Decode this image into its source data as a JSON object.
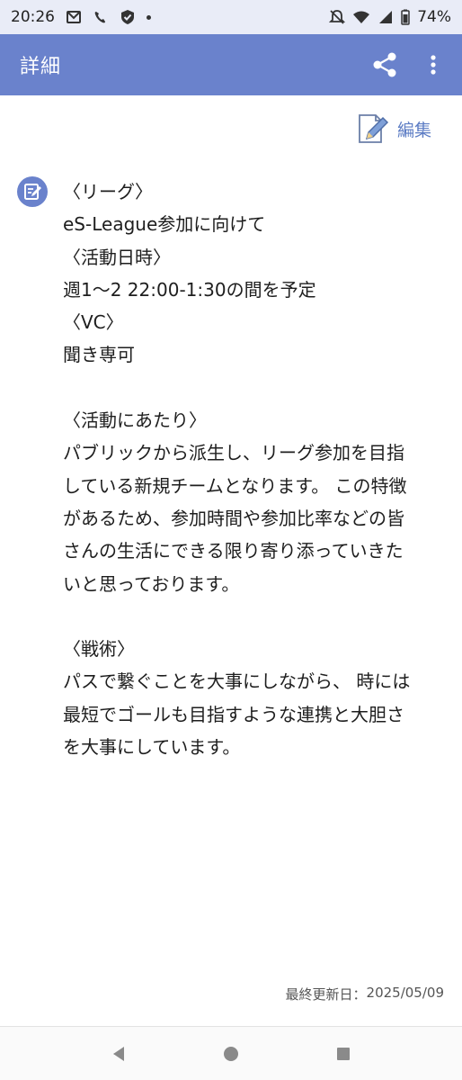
{
  "status_bar": {
    "time": "20:26",
    "battery": "74%",
    "left_icons": [
      "mail-icon",
      "wifi-call-icon",
      "shield-check-icon",
      "notification-dot-icon"
    ],
    "right_icons": [
      "mute-icon",
      "wifi-icon",
      "signal-icon",
      "battery-icon"
    ]
  },
  "app_bar": {
    "title": "詳細",
    "share_icon": "share-icon",
    "menu_icon": "more-vert-icon"
  },
  "edit": {
    "label": "編集",
    "icon": "edit-document-icon"
  },
  "note": {
    "icon": "note-edit-icon",
    "lines": [
      "〈リーグ〉",
      "eS-League参加に向けて",
      "〈活動日時〉",
      "週1〜2 22:00-1:30の間を予定",
      "〈VC〉",
      "聞き専可",
      "",
      "〈活動にあたり〉",
      "パブリックから派生し、リーグ参加を目指",
      "している新規チームとなります。 この特徴",
      "があるため、参加時間や参加比率などの皆",
      "さんの生活にできる限り寄り添っていきた",
      "いと思っております。",
      "",
      "〈戦術〉",
      "パスで繋ぐことを大事にしながら、 時には",
      "最短でゴールも目指すような連携と大胆さ",
      "を大事にしています。"
    ]
  },
  "footer": {
    "updated_label": "最終更新日：",
    "updated_date": "2025/05/09"
  },
  "nav_bar": {
    "back": "back-icon",
    "home": "home-icon",
    "recents": "recents-icon"
  },
  "colors": {
    "primary": "#6a82cc",
    "status_bg": "#e9ecf7",
    "edit_text": "#5c7cc4"
  }
}
